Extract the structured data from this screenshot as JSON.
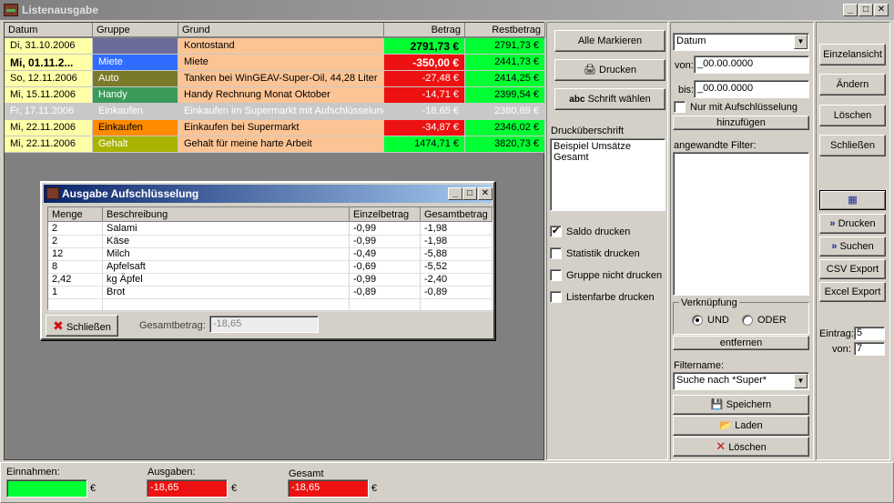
{
  "window": {
    "title": "Listenausgabe"
  },
  "colors": {
    "green": "#00ff33",
    "red": "#ee1111",
    "salmon": "#fcc494",
    "yellow": "#ffffa8"
  },
  "list": {
    "headers": [
      "Datum",
      "Gruppe",
      "Grund",
      "Betrag",
      "Restbetrag"
    ],
    "rows": [
      {
        "datum": "Di, 31.10.2006",
        "gruppe": "",
        "grund": "Kontostand",
        "betrag": "2791,73 €",
        "rest": "2791,73 €"
      },
      {
        "datum": "Mi, 01.11.2...",
        "gruppe": "Miete",
        "grund": "Miete",
        "betrag": "-350,00 €",
        "rest": "2441,73 €"
      },
      {
        "datum": "So, 12.11.2006",
        "gruppe": "Auto",
        "grund": "Tanken bei WinGEAV-Super-Oil, 44,28 Liter",
        "betrag": "-27,48 €",
        "rest": "2414,25 €"
      },
      {
        "datum": "Mi, 15.11.2006",
        "gruppe": "Handy",
        "grund": "Handy Rechnung Monat Oktober",
        "betrag": "-14,71 €",
        "rest": "2399,54 €"
      },
      {
        "datum": "Fr, 17.11.2006",
        "gruppe": "Einkaufen",
        "grund": "Einkaufen im Supermarkt mit Aufschlüsselung",
        "betrag": "-18,65 €",
        "rest": "2380,89 €"
      },
      {
        "datum": "Mi, 22.11.2006",
        "gruppe": "Einkaufen",
        "grund": "Einkaufen bei Supermarkt",
        "betrag": "-34,87 €",
        "rest": "2346,02 €"
      },
      {
        "datum": "Mi, 22.11.2006",
        "gruppe": "Gehalt",
        "grund": "Gehalt für meine harte Arbeit",
        "betrag": "1474,71 €",
        "rest": "3820,73 €"
      }
    ]
  },
  "sub": {
    "title": "Ausgabe Aufschlüsselung",
    "headers": [
      "Menge",
      "Beschreibung",
      "Einzelbetrag",
      "Gesamtbetrag"
    ],
    "rows": [
      {
        "menge": "2",
        "beschreibung": "Salami",
        "einzel": "-0,99",
        "gesamt": "-1,98"
      },
      {
        "menge": "2",
        "beschreibung": "Käse",
        "einzel": "-0,99",
        "gesamt": "-1,98"
      },
      {
        "menge": "12",
        "beschreibung": "Milch",
        "einzel": "-0,49",
        "gesamt": "-5,88"
      },
      {
        "menge": "8",
        "beschreibung": "Apfelsaft",
        "einzel": "-0,69",
        "gesamt": "-5,52"
      },
      {
        "menge": "2,42",
        "beschreibung": "kg Äpfel",
        "einzel": "-0,99",
        "gesamt": "-2,40"
      },
      {
        "menge": "1",
        "beschreibung": "Brot",
        "einzel": "-0,89",
        "gesamt": "-0,89"
      }
    ],
    "close_label": "Schließen",
    "total_label": "Gesamtbetrag:",
    "total_value": "-18,65"
  },
  "print_panel": {
    "mark_all": "Alle Markieren",
    "print": "Drucken",
    "font_prefix": "abc",
    "font": "Schrift wählen",
    "heading_label": "Drucküberschrift",
    "heading_value": "Beispiel Umsätze Gesamt",
    "checks": [
      {
        "label": "Saldo drucken",
        "mark": "✔"
      },
      {
        "label": "Statistik drucken",
        "mark": ""
      },
      {
        "label": "Gruppe nicht drucken",
        "mark": ""
      },
      {
        "label": "Listenfarbe drucken",
        "mark": ""
      }
    ]
  },
  "filter": {
    "field": "Datum",
    "from_label": "von:",
    "from_value": "_00.00.0000",
    "to_label": "bis:",
    "to_value": "_00.00.0000",
    "only_split": "Nur mit Aufschlüsselung",
    "add": "hinzufügen",
    "applied_label": "angewandte Filter:",
    "link_label": "Verknüpfung",
    "and": "UND",
    "or": "ODER",
    "remove": "entfernen",
    "name_label": "Filtername:",
    "name_value": "Suche nach *Super*",
    "save": "Speichern",
    "load": "Laden",
    "delete": "Löschen"
  },
  "right": {
    "single": "Einzelansicht",
    "change": "Ändern",
    "delete": "Löschen",
    "close": "Schließen",
    "print": "Drucken",
    "search": "Suchen",
    "csv": "CSV Export",
    "excel": "Excel Export",
    "entry_label": "Eintrag:",
    "entry_value": "5",
    "of_label": "von:",
    "of_value": "7"
  },
  "footer": {
    "income_label": "Einnahmen:",
    "income_value": "",
    "expense_label": "Ausgaben:",
    "expense_value": "-18,65",
    "total_label": "Gesamt",
    "total_value": "-18,65",
    "currency": "€"
  }
}
